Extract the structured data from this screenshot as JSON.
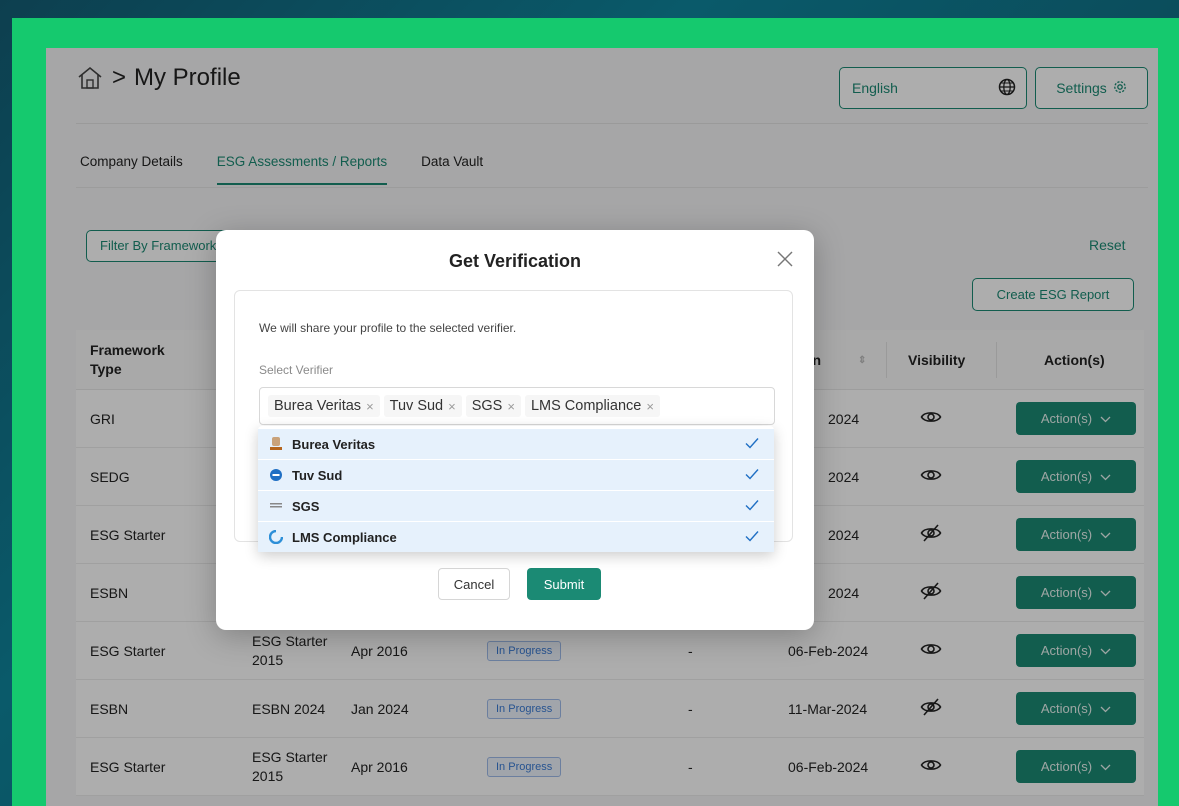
{
  "header": {
    "breadcrumb_sep": ">",
    "title": "My Profile"
  },
  "language": {
    "value": "English"
  },
  "settings": {
    "label": "Settings"
  },
  "tabs": [
    {
      "label": "Company Details"
    },
    {
      "label": "ESG Assessments / Reports"
    },
    {
      "label": "Data Vault"
    }
  ],
  "filters": {
    "framework_label": "Filter By Framework"
  },
  "reset_label": "Reset",
  "create_label": "Create ESG Report",
  "table": {
    "headers": {
      "framework_type": "Framework Type",
      "version": "ion",
      "visibility": "Visibility",
      "actions": "Action(s)"
    },
    "rows": [
      {
        "type": "GRI",
        "name": "",
        "period": "",
        "status": "",
        "dash": "",
        "date": "2024",
        "visible": true,
        "action": "Action(s)"
      },
      {
        "type": "SEDG",
        "name": "",
        "period": "",
        "status": "",
        "dash": "",
        "date": "2024",
        "visible": true,
        "action": "Action(s)"
      },
      {
        "type": "ESG Starter",
        "name": "",
        "period": "",
        "status": "",
        "dash": "",
        "date": "2024",
        "visible": false,
        "action": "Action(s)"
      },
      {
        "type": "ESBN",
        "name": "",
        "period": "",
        "status": "",
        "dash": "",
        "date": "2024",
        "visible": false,
        "action": "Action(s)"
      },
      {
        "type": "ESG Starter",
        "name": "ESG Starter 2015",
        "period": "Apr 2016",
        "status": "In Progress",
        "dash": "-",
        "date": "06-Feb-2024",
        "visible": true,
        "action": "Action(s)"
      },
      {
        "type": "ESBN",
        "name": "ESBN 2024",
        "period": "Jan 2024",
        "status": "In Progress",
        "dash": "-",
        "date": "11-Mar-2024",
        "visible": false,
        "action": "Action(s)"
      },
      {
        "type": "ESG Starter",
        "name": "ESG Starter 2015",
        "period": "Apr 2016",
        "status": "In Progress",
        "dash": "-",
        "date": "06-Feb-2024",
        "visible": true,
        "action": "Action(s)"
      }
    ]
  },
  "modal": {
    "title": "Get Verification",
    "share_text": "We will share your profile to the selected verifier.",
    "select_label": "Select Verifier",
    "chips": [
      "Burea Veritas",
      "Tuv Sud",
      "SGS",
      "LMS Compliance"
    ],
    "options": [
      {
        "label": "Burea Veritas",
        "icon": "burea-veritas-logo",
        "color": "#b5651d"
      },
      {
        "label": "Tuv Sud",
        "icon": "tuv-sud-logo",
        "color": "#1f6fc4"
      },
      {
        "label": "SGS",
        "icon": "sgs-logo",
        "color": "#888888"
      },
      {
        "label": "LMS Compliance",
        "icon": "lms-compliance-logo",
        "color": "#2d8fd8"
      }
    ],
    "cancel_label": "Cancel",
    "submit_label": "Submit"
  },
  "colors": {
    "accent": "#1b8a74",
    "frame": "#15c96e",
    "selection": "#e6f1fc"
  }
}
